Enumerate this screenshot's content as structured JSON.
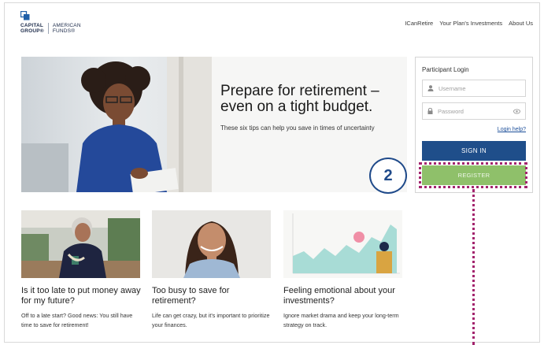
{
  "header": {
    "logo_left": "CAPITAL\nGROUP®",
    "logo_right": "AMERICAN\nFUNDS®",
    "nav": [
      "ICanRetire",
      "Your Plan's Investments",
      "About Us"
    ]
  },
  "hero": {
    "title": "Prepare for retirement – even on a tight budget.",
    "subtitle": "These six tips can help you save in times of uncertainty"
  },
  "login": {
    "title": "Participant Login",
    "username_placeholder": "Username",
    "password_placeholder": "Password",
    "help_link": "Login help?",
    "signin_label": "SIGN IN",
    "register_label": "REGISTER"
  },
  "annotation": {
    "step_number": "2",
    "highlight_color": "#a3246d",
    "circle_color": "#1f4a8a"
  },
  "articles": [
    {
      "title": "Is it too late to put money away for my future?",
      "text": "Off to a late start? Good news: You still have time to save for retirement!",
      "image": "older-woman-with-coffee-photo"
    },
    {
      "title": "Too busy to save for retirement?",
      "text": "Life can get crazy, but it's important to prioritize your finances.",
      "image": "smiling-woman-photo"
    },
    {
      "title": "Feeling emotional about your investments?",
      "text": "Ignore market drama and keep your long-term strategy on track.",
      "image": "market-chart-illustration"
    }
  ],
  "colors": {
    "brand_navy": "#1f4e8a",
    "register_green": "#8fc06a",
    "link_blue": "#1d4f9a"
  }
}
